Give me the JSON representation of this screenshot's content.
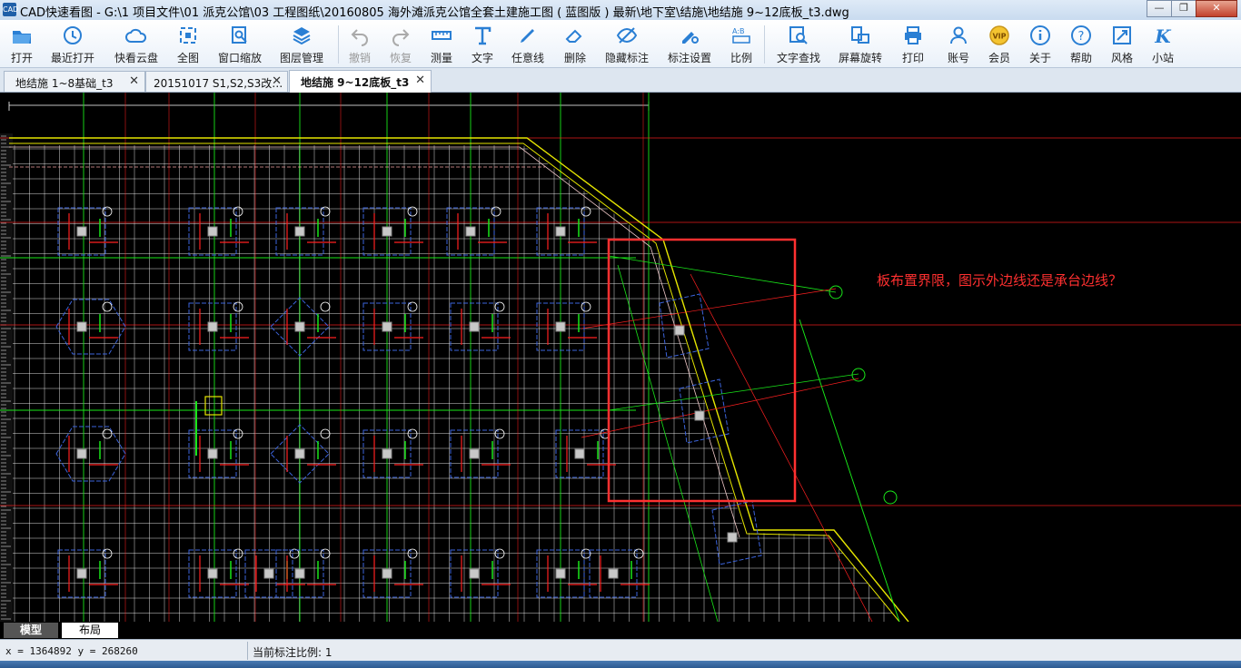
{
  "window": {
    "app_icon": "CAD",
    "title": "CAD快速看图 - G:\\1  项目文件\\01  派克公馆\\03  工程图纸\\20160805 海外滩派克公馆全套土建施工图 ( 蓝图版 ) 最新\\地下室\\结施\\地结施 9~12底板_t3.dwg",
    "minimize": "—",
    "maximize": "❐",
    "close": "✕"
  },
  "toolbar": [
    {
      "label": "打开",
      "icon": "folder-icon",
      "enabled": true
    },
    {
      "label": "最近打开",
      "icon": "history-icon",
      "enabled": true
    },
    {
      "label": "快看云盘",
      "icon": "cloud-icon",
      "enabled": true
    },
    {
      "label": "全图",
      "icon": "fit-all-icon",
      "enabled": true
    },
    {
      "label": "窗口缩放",
      "icon": "window-zoom-icon",
      "enabled": true
    },
    {
      "label": "图层管理",
      "icon": "layers-icon",
      "enabled": true
    },
    {
      "label": "撤销",
      "icon": "undo-icon",
      "enabled": false
    },
    {
      "label": "恢复",
      "icon": "redo-icon",
      "enabled": false
    },
    {
      "label": "测量",
      "icon": "measure-icon",
      "enabled": true
    },
    {
      "label": "文字",
      "icon": "text-icon",
      "enabled": true
    },
    {
      "label": "任意线",
      "icon": "pen-icon",
      "enabled": true
    },
    {
      "label": "删除",
      "icon": "eraser-icon",
      "enabled": true
    },
    {
      "label": "隐藏标注",
      "icon": "eye-hide-icon",
      "enabled": true
    },
    {
      "label": "标注设置",
      "icon": "annotation-settings-icon",
      "enabled": true
    },
    {
      "label": "比例",
      "icon": "scale-icon",
      "enabled": true
    },
    {
      "label": "文字查找",
      "icon": "text-search-icon",
      "enabled": true
    },
    {
      "label": "屏幕旋转",
      "icon": "rotate-screen-icon",
      "enabled": true
    },
    {
      "label": "打印",
      "icon": "printer-icon",
      "enabled": true
    },
    {
      "label": "账号",
      "icon": "user-icon",
      "enabled": true
    },
    {
      "label": "会员",
      "icon": "vip-icon",
      "enabled": true
    },
    {
      "label": "关于",
      "icon": "info-icon",
      "enabled": true
    },
    {
      "label": "帮助",
      "icon": "help-icon",
      "enabled": true
    },
    {
      "label": "风格",
      "icon": "style-icon",
      "enabled": true
    },
    {
      "label": "小站",
      "icon": "site-icon",
      "enabled": true
    }
  ],
  "tabs": [
    {
      "label": "地结施 1~8基础_t3",
      "close": "✕",
      "active": false
    },
    {
      "label": "20151017 S1,S2,S3改…",
      "close": "✕",
      "active": false
    },
    {
      "label": "地结施 9~12底板_t3",
      "close": "✕",
      "active": true
    }
  ],
  "canvas": {
    "annotation_note": "板布置界限，图示外边线还是承台边线？",
    "colors": {
      "background": "#000000",
      "grid": "#ffffff",
      "axis": "#19e619",
      "wall": "#e6e600",
      "pile_cap": "#3c64dc",
      "rebar": "#ff2020",
      "highlight": "#ff3030",
      "note": "#ff3030"
    }
  },
  "bottom_tabs": {
    "model": "模型",
    "layout": "布局"
  },
  "status": {
    "coords": "x = 1364892  y = 268260",
    "scale": "当前标注比例: 1"
  }
}
